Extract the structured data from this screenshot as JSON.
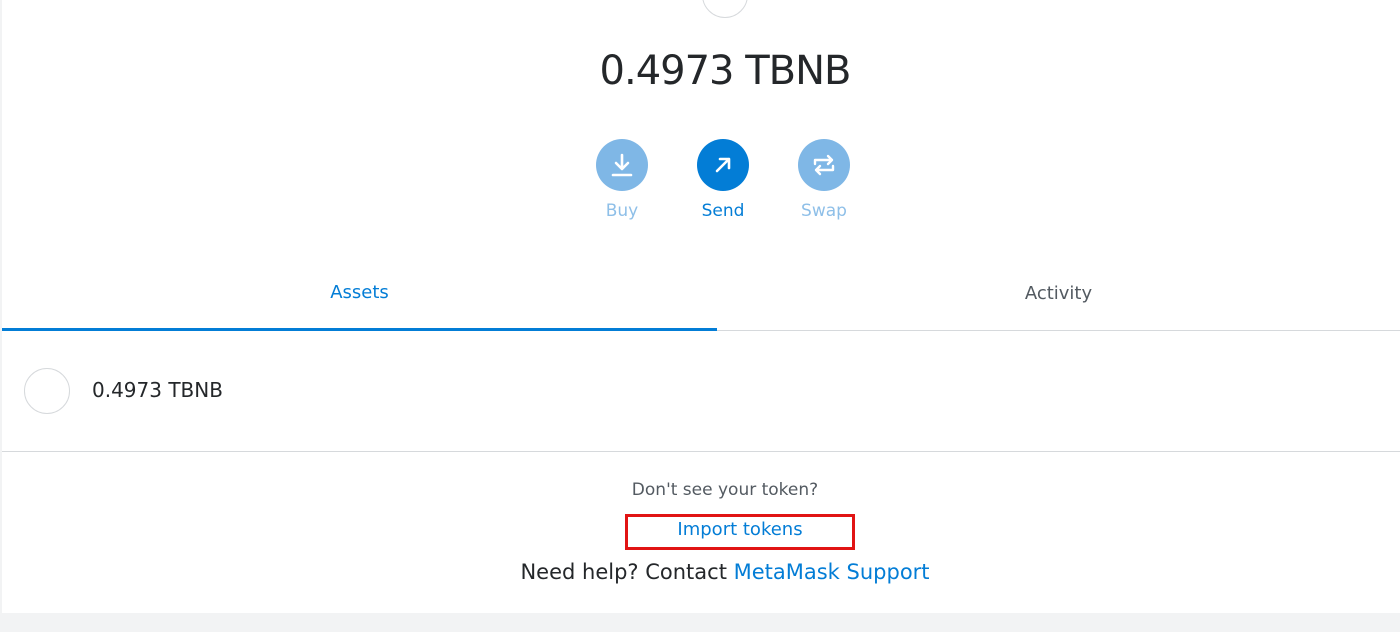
{
  "account": {
    "balance_display": "0.4973 TBNB"
  },
  "actions": {
    "buy_label": "Buy",
    "send_label": "Send",
    "swap_label": "Swap"
  },
  "tabs": {
    "assets_label": "Assets",
    "activity_label": "Activity",
    "active": "Assets"
  },
  "assets": [
    {
      "amount": "0.4973 TBNB"
    }
  ],
  "help": {
    "question": "Don't see your token?",
    "import_label": "Import tokens",
    "need_help_prefix": "Need help? Contact ",
    "support_link": "MetaMask Support"
  },
  "colors": {
    "accent": "#037dd6",
    "accent_light": "#7fb7e6",
    "highlight": "#e11414"
  },
  "icons": {
    "buy": "download-icon",
    "send": "arrow-up-right-icon",
    "swap": "swap-arrows-icon"
  }
}
